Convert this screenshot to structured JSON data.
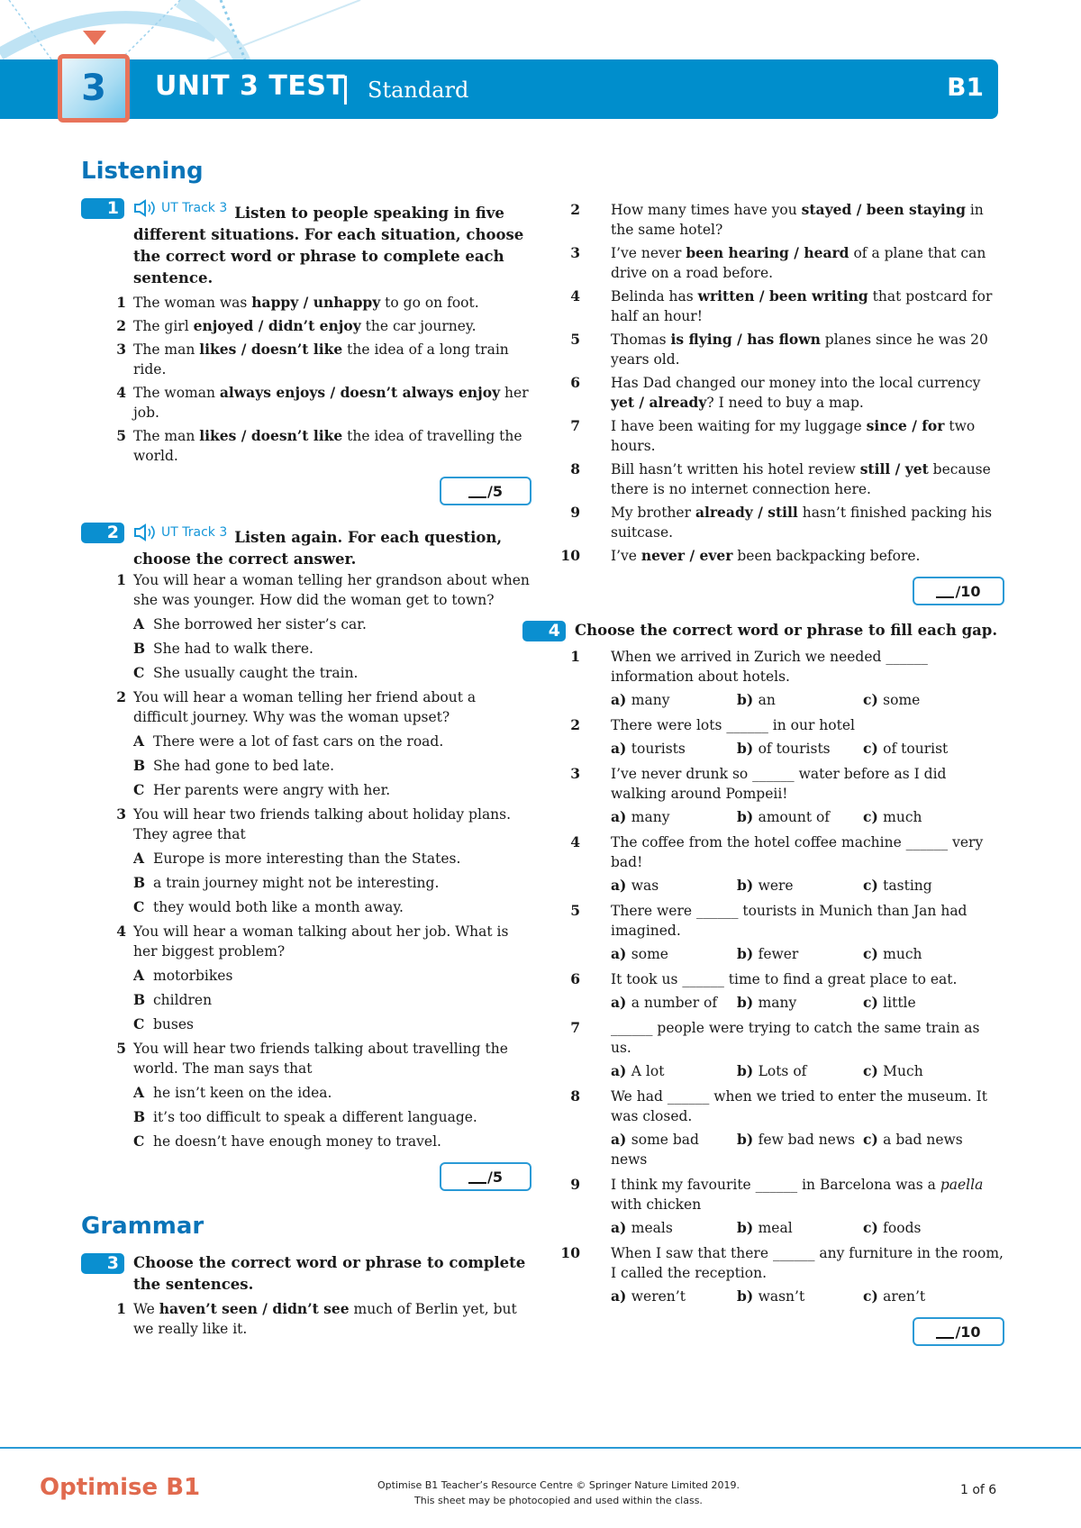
{
  "header": {
    "unit_number": "3",
    "title": "UNIT 3 TEST",
    "subtitle": "Standard",
    "level": "B1",
    "accent_color": "#008ecc",
    "badge_color": "#e8735a"
  },
  "listening": {
    "section_title": "Listening",
    "ex1": {
      "number": "1",
      "audio_label": "UT Track 3",
      "instruction": "Listen to people speaking in five different situations. For each situation, choose the correct word or phrase to complete each sentence.",
      "items": [
        {
          "num": "1",
          "segs": [
            {
              "t": "The woman was "
            },
            {
              "t": "happy / unhappy",
              "b": true
            },
            {
              "t": " to go on foot."
            }
          ]
        },
        {
          "num": "2",
          "segs": [
            {
              "t": "The girl "
            },
            {
              "t": "enjoyed / didn’t enjoy",
              "b": true
            },
            {
              "t": " the car journey."
            }
          ]
        },
        {
          "num": "3",
          "segs": [
            {
              "t": "The man "
            },
            {
              "t": "likes / doesn’t like",
              "b": true
            },
            {
              "t": " the idea of a long train ride."
            }
          ]
        },
        {
          "num": "4",
          "segs": [
            {
              "t": "The woman "
            },
            {
              "t": "always enjoys / doesn’t always enjoy",
              "b": true
            },
            {
              "t": " her job."
            }
          ]
        },
        {
          "num": "5",
          "segs": [
            {
              "t": "The man "
            },
            {
              "t": "likes / doesn’t like",
              "b": true
            },
            {
              "t": " the idea of travelling the world."
            }
          ]
        }
      ],
      "score_total": "/5"
    },
    "ex2": {
      "number": "2",
      "audio_label": "UT Track 3",
      "instruction": "Listen again. For each question, choose the correct answer.",
      "items": [
        {
          "num": "1",
          "question": "You will hear a woman telling her grandson about when she was younger. How did the woman get to town?",
          "options": [
            {
              "letter": "A",
              "text": "She borrowed her sister’s car."
            },
            {
              "letter": "B",
              "text": "She had to walk there."
            },
            {
              "letter": "C",
              "text": "She usually caught the train."
            }
          ]
        },
        {
          "num": "2",
          "question": "You will hear a woman telling her friend about a difficult journey. Why was the woman upset?",
          "options": [
            {
              "letter": "A",
              "text": "There were a lot of fast cars on the road."
            },
            {
              "letter": "B",
              "text": "She had gone to bed late."
            },
            {
              "letter": "C",
              "text": "Her parents were angry with her."
            }
          ]
        },
        {
          "num": "3",
          "question": "You will hear two friends talking about holiday plans. They agree that",
          "options": [
            {
              "letter": "A",
              "text": "Europe is more interesting than the States."
            },
            {
              "letter": "B",
              "text": "a train journey might not be interesting."
            },
            {
              "letter": "C",
              "text": "they would both like a month away."
            }
          ]
        },
        {
          "num": "4",
          "question": "You will hear a woman talking about her job. What is her biggest problem?",
          "options": [
            {
              "letter": "A",
              "text": "motorbikes"
            },
            {
              "letter": "B",
              "text": "children"
            },
            {
              "letter": "C",
              "text": "buses"
            }
          ]
        },
        {
          "num": "5",
          "question": "You will hear two friends talking about travelling the world. The man says that",
          "options": [
            {
              "letter": "A",
              "text": "he isn’t keen on the idea."
            },
            {
              "letter": "B",
              "text": "it’s too difficult to speak a different language."
            },
            {
              "letter": "C",
              "text": "he doesn’t have enough money to travel."
            }
          ]
        }
      ],
      "score_total": "/5"
    }
  },
  "grammar": {
    "section_title": "Grammar",
    "ex3": {
      "number": "3",
      "instruction": "Choose the correct word or phrase to complete the sentences.",
      "items": [
        {
          "num": "1",
          "segs": [
            {
              "t": "We "
            },
            {
              "t": "haven’t seen / didn’t see",
              "b": true
            },
            {
              "t": " much of Berlin yet, but we really like it."
            }
          ]
        },
        {
          "num": "2",
          "segs": [
            {
              "t": "How many times have you "
            },
            {
              "t": "stayed / been staying",
              "b": true
            },
            {
              "t": " in the same hotel?"
            }
          ]
        },
        {
          "num": "3",
          "segs": [
            {
              "t": "I’ve never "
            },
            {
              "t": "been hearing / heard",
              "b": true
            },
            {
              "t": " of a plane that can drive on a road before."
            }
          ]
        },
        {
          "num": "4",
          "segs": [
            {
              "t": "Belinda has "
            },
            {
              "t": "written / been writing",
              "b": true
            },
            {
              "t": " that postcard for half an hour!"
            }
          ]
        },
        {
          "num": "5",
          "segs": [
            {
              "t": "Thomas "
            },
            {
              "t": "is flying / has flown",
              "b": true
            },
            {
              "t": " planes since he was 20 years old."
            }
          ]
        },
        {
          "num": "6",
          "segs": [
            {
              "t": "Has Dad changed our money into the local currency "
            },
            {
              "t": "yet / already",
              "b": true
            },
            {
              "t": "? I need to buy a map."
            }
          ]
        },
        {
          "num": "7",
          "segs": [
            {
              "t": "I have been waiting for my luggage "
            },
            {
              "t": "since / for",
              "b": true
            },
            {
              "t": " two hours."
            }
          ]
        },
        {
          "num": "8",
          "segs": [
            {
              "t": "Bill hasn’t written his hotel review "
            },
            {
              "t": "still / yet",
              "b": true
            },
            {
              "t": " because there is no internet connection here."
            }
          ]
        },
        {
          "num": "9",
          "segs": [
            {
              "t": "My brother "
            },
            {
              "t": "already / still",
              "b": true
            },
            {
              "t": " hasn’t finished packing his suitcase."
            }
          ]
        },
        {
          "num": "10",
          "segs": [
            {
              "t": "I’ve "
            },
            {
              "t": "never / ever",
              "b": true
            },
            {
              "t": " been backpacking before."
            }
          ]
        }
      ],
      "score_total": "/10"
    },
    "ex4": {
      "number": "4",
      "instruction": "Choose the correct word or phrase to fill each gap.",
      "items": [
        {
          "num": "1",
          "segs": [
            {
              "t": "When we arrived in Zurich we needed ______ information about hotels."
            }
          ],
          "choices": [
            {
              "l": "a)",
              "t": "many"
            },
            {
              "l": "b)",
              "t": "an"
            },
            {
              "l": "c)",
              "t": "some"
            }
          ]
        },
        {
          "num": "2",
          "segs": [
            {
              "t": "There were lots ______ in our hotel"
            }
          ],
          "choices": [
            {
              "l": "a)",
              "t": "tourists"
            },
            {
              "l": "b)",
              "t": "of tourists"
            },
            {
              "l": "c)",
              "t": "of tourist"
            }
          ]
        },
        {
          "num": "3",
          "segs": [
            {
              "t": "I’ve never drunk so ______ water before as I did walking around Pompeii!"
            }
          ],
          "choices": [
            {
              "l": "a)",
              "t": "many"
            },
            {
              "l": "b)",
              "t": "amount of"
            },
            {
              "l": "c)",
              "t": "much"
            }
          ]
        },
        {
          "num": "4",
          "segs": [
            {
              "t": "The coffee from the hotel coffee machine ______ very bad!"
            }
          ],
          "choices": [
            {
              "l": "a)",
              "t": "was"
            },
            {
              "l": "b)",
              "t": "were"
            },
            {
              "l": "c)",
              "t": "tasting"
            }
          ]
        },
        {
          "num": "5",
          "segs": [
            {
              "t": "There were ______ tourists in Munich than Jan had imagined."
            }
          ],
          "choices": [
            {
              "l": "a)",
              "t": "some"
            },
            {
              "l": "b)",
              "t": "fewer"
            },
            {
              "l": "c)",
              "t": "much"
            }
          ]
        },
        {
          "num": "6",
          "segs": [
            {
              "t": "It took us ______ time to find a great place to eat."
            }
          ],
          "choices": [
            {
              "l": "a)",
              "t": "a number of"
            },
            {
              "l": "b)",
              "t": "many"
            },
            {
              "l": "c)",
              "t": "little"
            }
          ]
        },
        {
          "num": "7",
          "segs": [
            {
              "t": "______ people were trying to catch the same train as us."
            }
          ],
          "choices": [
            {
              "l": "a)",
              "t": "A lot"
            },
            {
              "l": "b)",
              "t": "Lots of"
            },
            {
              "l": "c)",
              "t": "Much"
            }
          ]
        },
        {
          "num": "8",
          "segs": [
            {
              "t": "We had ______ when we tried to enter the museum. It was closed."
            }
          ],
          "choices": [
            {
              "l": "a)",
              "t": "some bad news"
            },
            {
              "l": "b)",
              "t": "few bad news"
            },
            {
              "l": "c)",
              "t": "a bad news"
            }
          ]
        },
        {
          "num": "9",
          "segs": [
            {
              "t": "I think my favourite ______ in Barcelona was a "
            },
            {
              "t": "paella",
              "i": true
            },
            {
              "t": " with chicken"
            }
          ],
          "choices": [
            {
              "l": "a)",
              "t": "meals"
            },
            {
              "l": "b)",
              "t": "meal"
            },
            {
              "l": "c)",
              "t": "foods"
            }
          ]
        },
        {
          "num": "10",
          "segs": [
            {
              "t": "When I saw that there ______ any furniture in the room, I called the reception."
            }
          ],
          "choices": [
            {
              "l": "a)",
              "t": "weren’t"
            },
            {
              "l": "b)",
              "t": "wasn’t"
            },
            {
              "l": "c)",
              "t": "aren’t"
            }
          ]
        }
      ],
      "score_total": "/10"
    }
  },
  "icons": {
    "audio": "speaker-icon"
  },
  "footer": {
    "brand": "Optimise B1",
    "copyright_line1": "Optimise B1 Teacher’s Resource Centre © Springer Nature Limited 2019.",
    "copyright_line2": "This sheet may be photocopied and used within the class.",
    "page": "1 of 6",
    "brand_color": "#e06a4e"
  }
}
